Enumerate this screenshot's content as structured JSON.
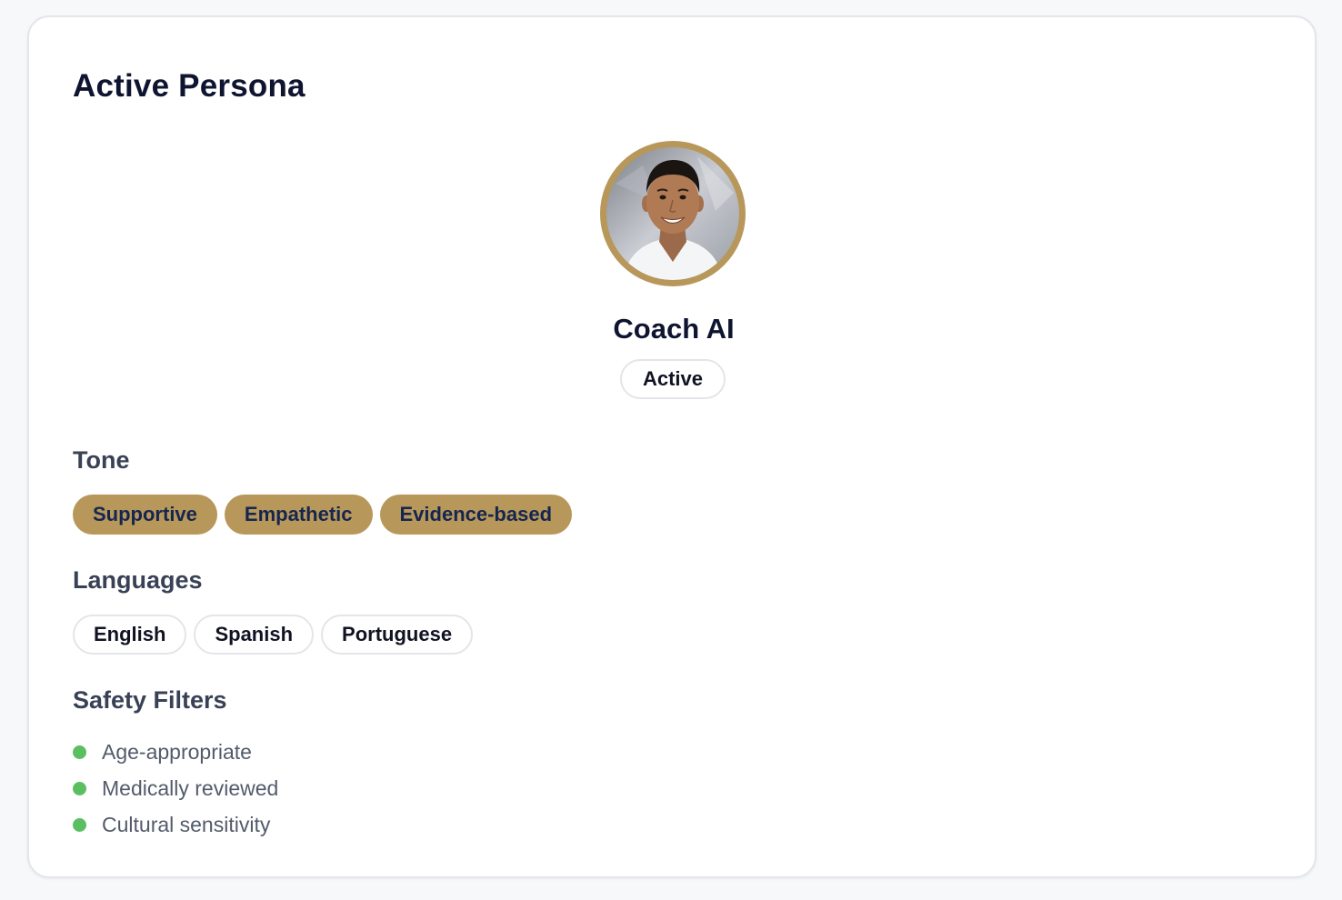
{
  "card": {
    "title": "Active Persona"
  },
  "persona": {
    "name": "Coach AI",
    "status": "Active",
    "avatar_icon": "coach-portrait"
  },
  "tone": {
    "label": "Tone",
    "chips": [
      "Supportive",
      "Empathetic",
      "Evidence-based"
    ]
  },
  "languages": {
    "label": "Languages",
    "chips": [
      "English",
      "Spanish",
      "Portuguese"
    ]
  },
  "safety": {
    "label": "Safety Filters",
    "items": [
      "Age-appropriate",
      "Medically reviewed",
      "Cultural sensitivity"
    ]
  },
  "colors": {
    "accent_gold": "#b8975a",
    "tone_text": "#15264f",
    "status_dot": "#5bbf62",
    "title_text": "#0f1430"
  }
}
